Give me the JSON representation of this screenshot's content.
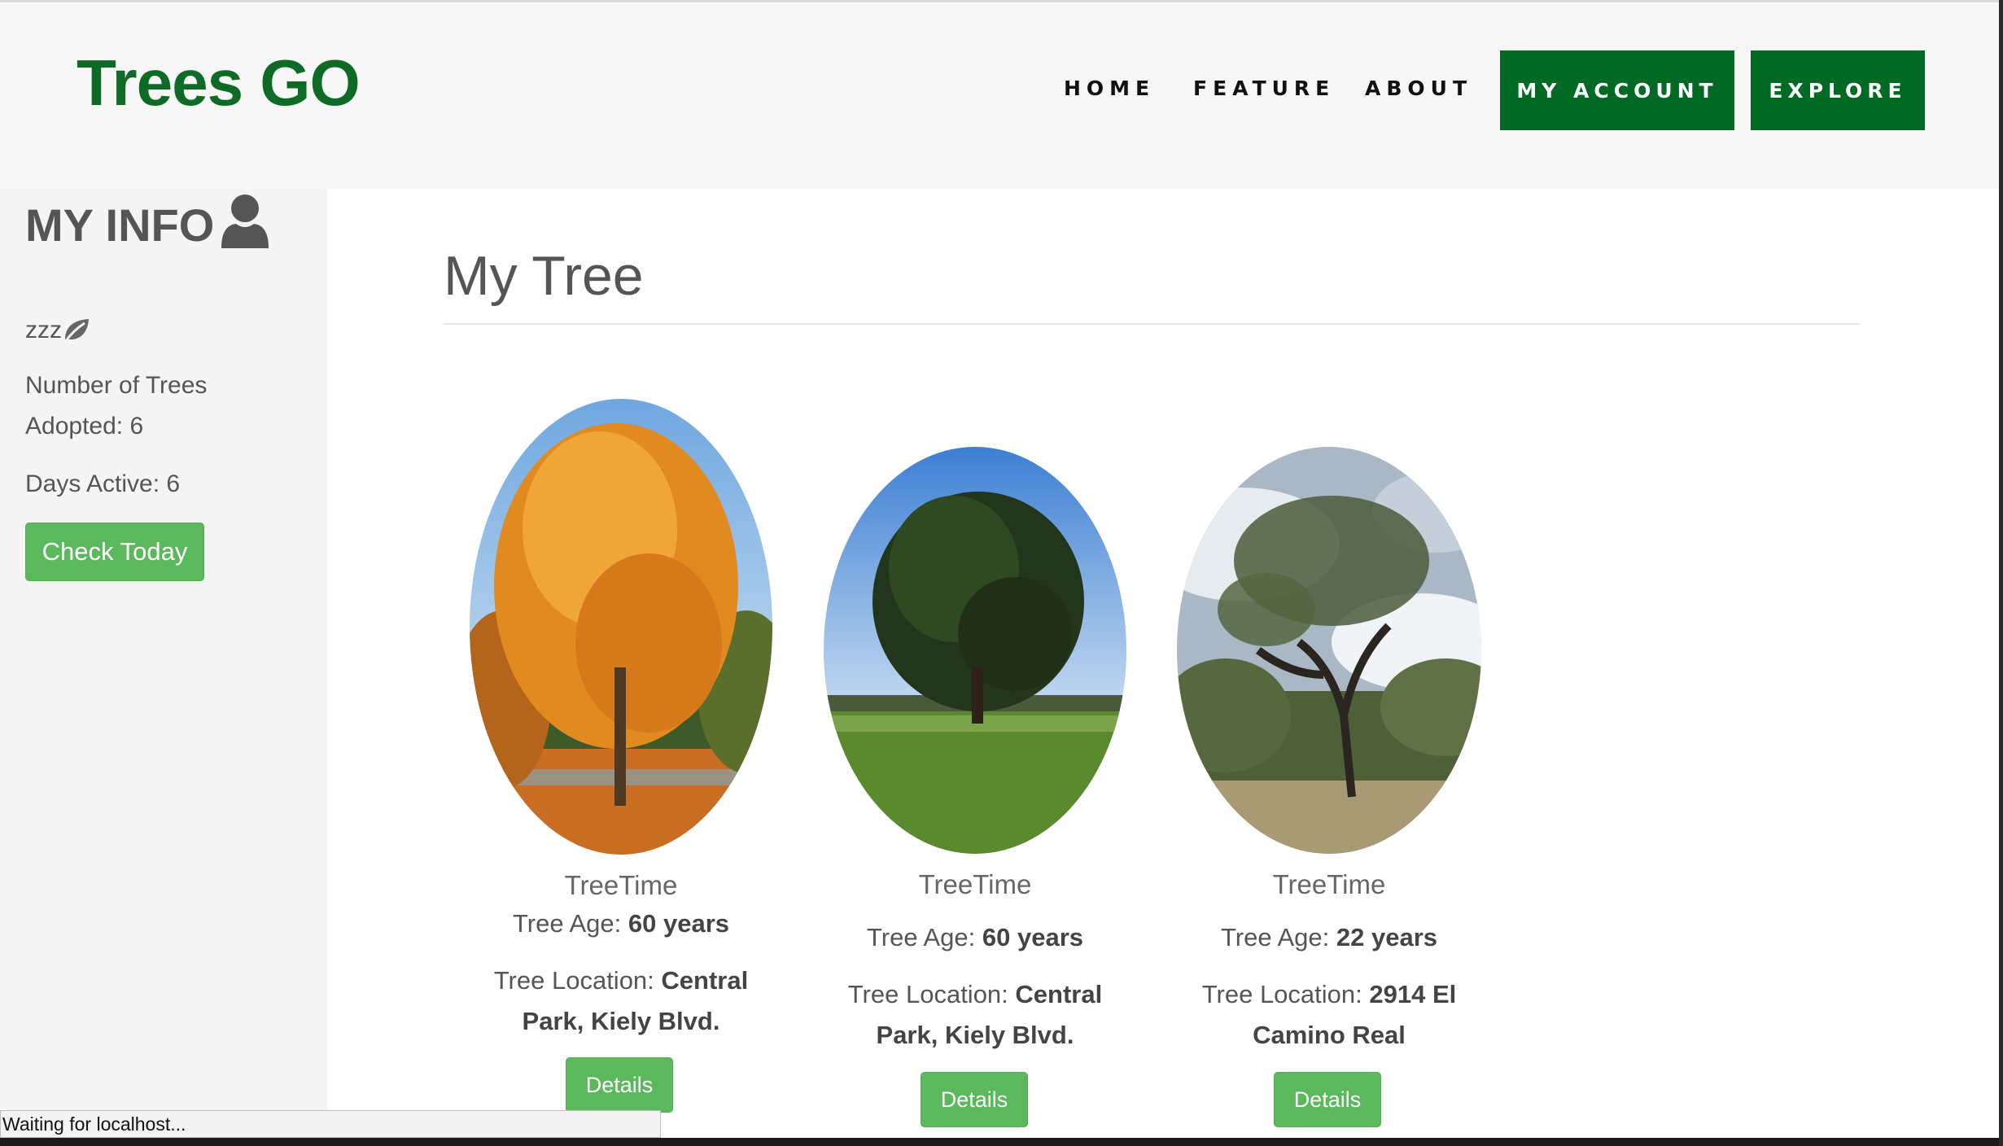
{
  "header": {
    "logo": "Trees GO",
    "nav": [
      "HOME",
      "FEATURE",
      "ABOUT"
    ],
    "buttons": [
      "MY ACCOUNT",
      "EXPLORE"
    ],
    "brand_color": "#006a24"
  },
  "sidebar": {
    "title": "MY INFO",
    "username": "zzz",
    "trees_adopted_line1": "Number of Trees",
    "trees_adopted_line2": "Adopted: 6",
    "days_active": "Days Active: 6",
    "check_button": "Check Today",
    "icons": [
      "user-icon",
      "leaf-icon"
    ]
  },
  "main": {
    "title": "My Tree",
    "trees": [
      {
        "name": "TreeTime",
        "age_label": "Tree Age:",
        "age_value": "60 years",
        "location_label": "Tree Location:",
        "location_value_1": "Central",
        "location_value_2": "Park, Kiely Blvd.",
        "button": "Details"
      },
      {
        "name": "TreeTime",
        "age_label": "Tree Age:",
        "age_value": "60 years",
        "location_label": "Tree Location:",
        "location_value_1": "Central",
        "location_value_2": "Park, Kiely Blvd.",
        "button": "Details"
      },
      {
        "name": "TreeTime",
        "age_label": "Tree Age:",
        "age_value": "22 years",
        "location_label": "Tree Location:",
        "location_value_1": "2914 El",
        "location_value_2": "Camino Real",
        "button": "Details"
      }
    ]
  },
  "status_bar": {
    "text": "Waiting for localhost..."
  },
  "colors": {
    "accent_green": "#5cb85c",
    "dark_green": "#0e6b26"
  }
}
